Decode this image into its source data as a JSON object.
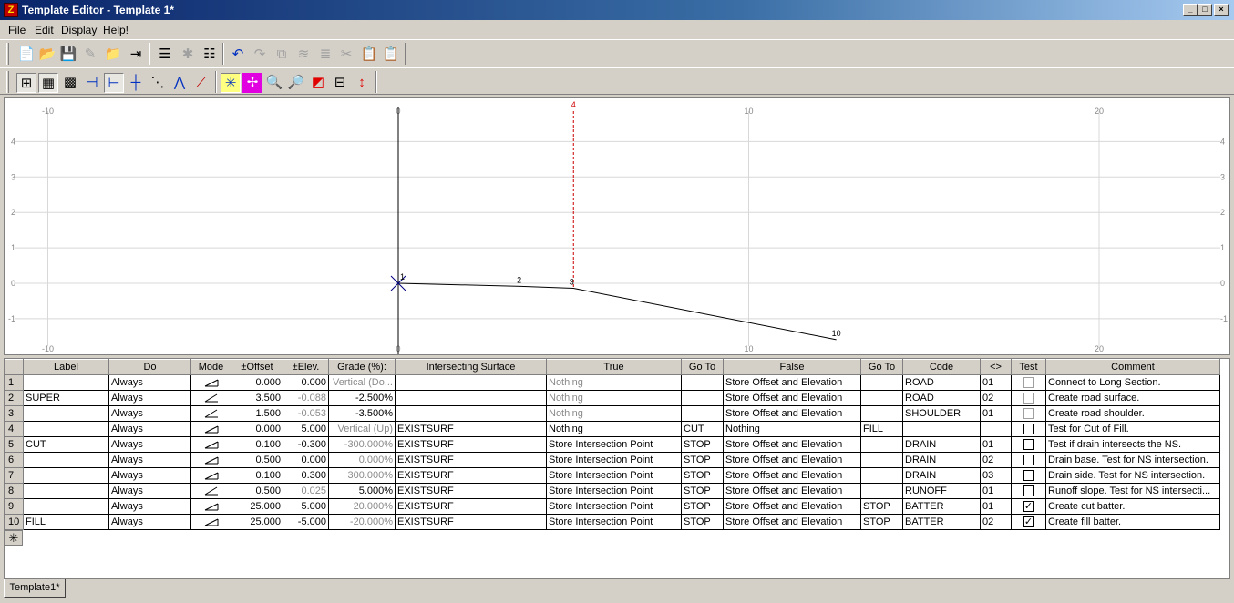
{
  "window": {
    "title": "Template Editor - Template 1*",
    "buttons": [
      "_",
      "□",
      "×"
    ]
  },
  "menu": [
    "File",
    "Edit",
    "Display",
    "Help!"
  ],
  "canvas": {
    "x_top_ticks": [
      "-10",
      "0",
      "10",
      "20"
    ],
    "x_bottom_ticks": [
      "-10",
      "0",
      "10",
      "20"
    ],
    "y_ticks": [
      "4",
      "3",
      "2",
      "1",
      "0",
      "-1"
    ],
    "marker_label": "4",
    "points": [
      {
        "label": "1",
        "offset": 0.0,
        "elev": 0.0
      },
      {
        "label": "2",
        "offset": 3.5,
        "elev": -0.088
      },
      {
        "label": "3",
        "offset": 5.0,
        "elev": -0.141
      },
      {
        "label": "10",
        "offset": 12.5,
        "elev": -1.591
      }
    ],
    "colors": {
      "grid": "#d8d8d8",
      "axis": "#000000",
      "marker": "#cc0000",
      "line": "#000000"
    }
  },
  "table": {
    "headers": [
      "",
      "Label",
      "Do",
      "Mode",
      "±Offset",
      "±Elev.",
      "Grade (%):",
      "Intersecting Surface",
      "True",
      "Go To",
      "False",
      "Go To",
      "Code",
      "<>",
      "Test",
      "Comment"
    ],
    "rows": [
      {
        "n": "1",
        "label": "",
        "do": "Always",
        "mode": "flat",
        "offset": "0.000",
        "elev": "0.000",
        "grade": "Vertical (Do...",
        "grade_gray": true,
        "elev_gray": false,
        "surface": "",
        "true": "Nothing",
        "true_gray": true,
        "goto1": "",
        "false": "Store Offset and Elevation",
        "goto2": "",
        "code": "ROAD",
        "ord": "01",
        "test": "gray",
        "comment": "Connect to Long Section."
      },
      {
        "n": "2",
        "label": "SUPER",
        "do": "Always",
        "mode": "slope",
        "offset": "3.500",
        "elev": "-0.088",
        "grade": "-2.500%",
        "grade_gray": false,
        "elev_gray": true,
        "surface": "",
        "true": "Nothing",
        "true_gray": true,
        "goto1": "",
        "false": "Store Offset and Elevation",
        "goto2": "",
        "code": "ROAD",
        "ord": "02",
        "test": "gray",
        "comment": "Create road surface."
      },
      {
        "n": "3",
        "label": "",
        "do": "Always",
        "mode": "slope",
        "offset": "1.500",
        "elev": "-0.053",
        "grade": "-3.500%",
        "grade_gray": false,
        "elev_gray": true,
        "surface": "",
        "true": "Nothing",
        "true_gray": true,
        "goto1": "",
        "false": "Store Offset and Elevation",
        "goto2": "",
        "code": "SHOULDER",
        "ord": "01",
        "test": "gray",
        "comment": "Create road shoulder."
      },
      {
        "n": "4",
        "label": "",
        "do": "Always",
        "mode": "flat",
        "offset": "0.000",
        "elev": "5.000",
        "grade": "Vertical (Up)",
        "grade_gray": true,
        "elev_gray": false,
        "surface": "EXISTSURF",
        "true": "Nothing",
        "true_gray": false,
        "goto1": "CUT",
        "false": "Nothing",
        "goto2": "FILL",
        "code": "",
        "ord": "",
        "test": "empty",
        "comment": "Test for Cut of Fill."
      },
      {
        "n": "5",
        "label": "CUT",
        "do": "Always",
        "mode": "flat",
        "offset": "0.100",
        "elev": "-0.300",
        "grade": "-300.000%",
        "grade_gray": true,
        "elev_gray": false,
        "surface": "EXISTSURF",
        "true": "Store Intersection Point",
        "true_gray": false,
        "goto1": "STOP",
        "false": "Store Offset and Elevation",
        "goto2": "",
        "code": "DRAIN",
        "ord": "01",
        "test": "empty",
        "comment": "Test if drain intersects the NS."
      },
      {
        "n": "6",
        "label": "",
        "do": "Always",
        "mode": "flat",
        "offset": "0.500",
        "elev": "0.000",
        "grade": "0.000%",
        "grade_gray": true,
        "elev_gray": false,
        "surface": "EXISTSURF",
        "true": "Store Intersection Point",
        "true_gray": false,
        "goto1": "STOP",
        "false": "Store Offset and Elevation",
        "goto2": "",
        "code": "DRAIN",
        "ord": "02",
        "test": "empty",
        "comment": "Drain base. Test for NS intersection."
      },
      {
        "n": "7",
        "label": "",
        "do": "Always",
        "mode": "flat",
        "offset": "0.100",
        "elev": "0.300",
        "grade": "300.000%",
        "grade_gray": true,
        "elev_gray": false,
        "surface": "EXISTSURF",
        "true": "Store Intersection Point",
        "true_gray": false,
        "goto1": "STOP",
        "false": "Store Offset and Elevation",
        "goto2": "",
        "code": "DRAIN",
        "ord": "03",
        "test": "empty",
        "comment": "Drain side. Test for NS intersection."
      },
      {
        "n": "8",
        "label": "",
        "do": "Always",
        "mode": "slope",
        "offset": "0.500",
        "elev": "0.025",
        "grade": "5.000%",
        "grade_gray": false,
        "elev_gray": true,
        "surface": "EXISTSURF",
        "true": "Store Intersection Point",
        "true_gray": false,
        "goto1": "STOP",
        "false": "Store Offset and Elevation",
        "goto2": "",
        "code": "RUNOFF",
        "ord": "01",
        "test": "empty",
        "comment": "Runoff slope. Test for NS intersecti..."
      },
      {
        "n": "9",
        "label": "",
        "do": "Always",
        "mode": "flat",
        "offset": "25.000",
        "elev": "5.000",
        "grade": "20.000%",
        "grade_gray": true,
        "elev_gray": false,
        "surface": "EXISTSURF",
        "true": "Store Intersection Point",
        "true_gray": false,
        "goto1": "STOP",
        "false": "Store Offset and Elevation",
        "goto2": "STOP",
        "code": "BATTER",
        "ord": "01",
        "test": "checked",
        "comment": "Create cut batter."
      },
      {
        "n": "10",
        "label": "FILL",
        "do": "Always",
        "mode": "flat",
        "offset": "25.000",
        "elev": "-5.000",
        "grade": "-20.000%",
        "grade_gray": true,
        "elev_gray": false,
        "surface": "EXISTSURF",
        "true": "Store Intersection Point",
        "true_gray": false,
        "goto1": "STOP",
        "false": "Store Offset and Elevation",
        "goto2": "STOP",
        "code": "BATTER",
        "ord": "02",
        "test": "checked",
        "comment": "Create fill batter."
      }
    ],
    "new_row_symbol": "✳"
  },
  "tabs": [
    "Template1*"
  ]
}
